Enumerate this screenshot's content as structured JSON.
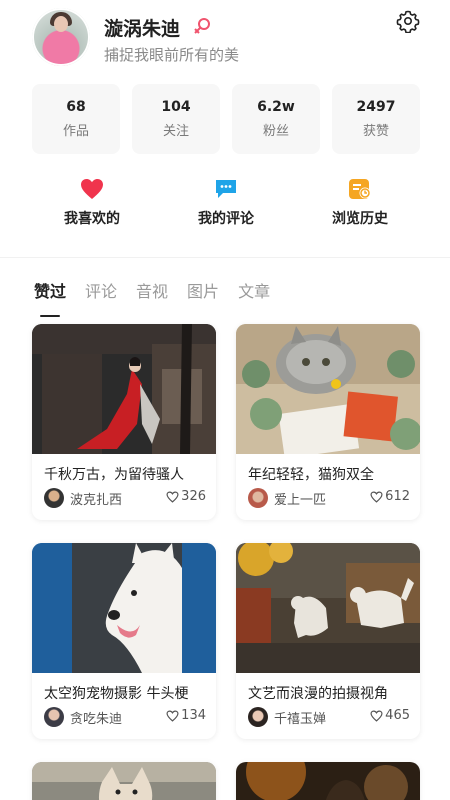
{
  "profile": {
    "name": "漩涡朱迪",
    "bio": "捕捉我眼前所有的美",
    "gender_icon": "female-icon",
    "settings_icon": "gear-icon"
  },
  "stats": [
    {
      "value": "68",
      "label": "作品"
    },
    {
      "value": "104",
      "label": "关注"
    },
    {
      "value": "6.2w",
      "label": "粉丝"
    },
    {
      "value": "2497",
      "label": "获赞"
    }
  ],
  "quick_actions": [
    {
      "label": "我喜欢的",
      "icon": "heart-icon",
      "color": "#f0344d"
    },
    {
      "label": "我的评论",
      "icon": "comment-icon",
      "color": "#1fa4e8"
    },
    {
      "label": "浏览历史",
      "icon": "history-icon",
      "color": "#f5a623"
    }
  ],
  "tabs": [
    {
      "label": "赞过",
      "active": true
    },
    {
      "label": "评论",
      "active": false
    },
    {
      "label": "音视",
      "active": false
    },
    {
      "label": "图片",
      "active": false
    },
    {
      "label": "文章",
      "active": false
    }
  ],
  "posts": [
    {
      "title": "千秋万古，为留待骚人",
      "author": "波克扎西",
      "likes": "326"
    },
    {
      "title": "年纪轻轻，猫狗双全",
      "author": "爱上一匹",
      "likes": "612"
    },
    {
      "title": "太空狗宠物摄影 牛头梗",
      "author": "贪吃朱迪",
      "likes": "134"
    },
    {
      "title": "文艺而浪漫的拍摄视角",
      "author": "千禧玉婵",
      "likes": "465"
    }
  ]
}
